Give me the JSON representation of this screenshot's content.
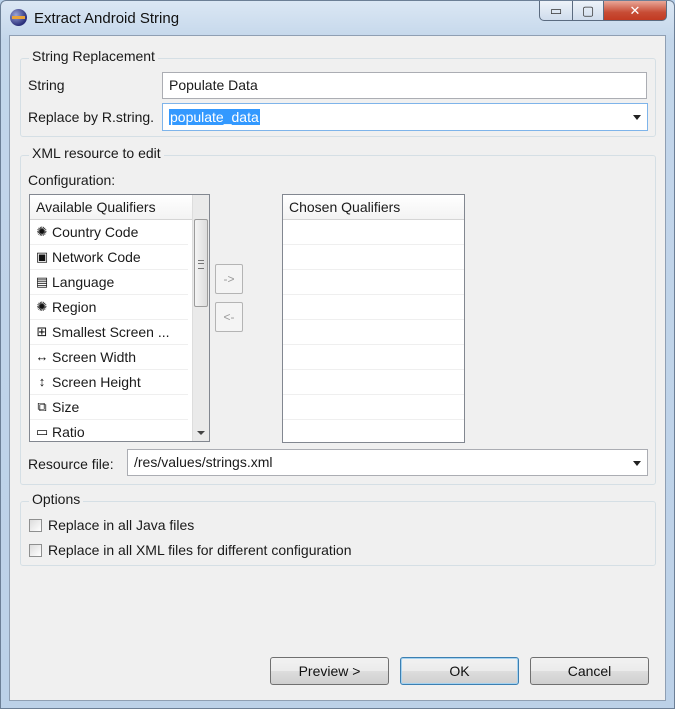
{
  "window": {
    "title": "Extract Android String",
    "controls": {
      "minimize": "▭",
      "maximize": "▢",
      "close": "✕"
    }
  },
  "string_replacement": {
    "group_title": "String Replacement",
    "string_label": "String",
    "string_value": "Populate Data",
    "replace_label": "Replace by R.string.",
    "replace_value": "populate_data"
  },
  "xml_resource": {
    "group_title": "XML resource to edit",
    "configuration_label": "Configuration:",
    "available_header": "Available Qualifiers",
    "available_qualifiers": [
      {
        "icon": "country-code-icon",
        "glyph": "✺",
        "label": "Country Code"
      },
      {
        "icon": "network-code-icon",
        "glyph": "▣",
        "label": "Network Code"
      },
      {
        "icon": "language-icon",
        "glyph": "▤",
        "label": "Language"
      },
      {
        "icon": "region-icon",
        "glyph": "✺",
        "label": "Region"
      },
      {
        "icon": "smallest-screen-icon",
        "glyph": "⊞",
        "label": "Smallest Screen ..."
      },
      {
        "icon": "screen-width-icon",
        "glyph": "↔",
        "label": "Screen Width"
      },
      {
        "icon": "screen-height-icon",
        "glyph": "↕",
        "label": "Screen Height"
      },
      {
        "icon": "size-icon",
        "glyph": "⧉",
        "label": "Size"
      },
      {
        "icon": "ratio-icon",
        "glyph": "▭",
        "label": "Ratio"
      }
    ],
    "add_button": "->",
    "remove_button": "<-",
    "chosen_header": "Chosen Qualifiers",
    "resource_file_label": "Resource file:",
    "resource_file_value": "/res/values/strings.xml"
  },
  "options": {
    "group_title": "Options",
    "replace_java": "Replace in all Java files",
    "replace_xml": "Replace in all XML files for different configuration"
  },
  "buttons": {
    "preview": "Preview >",
    "ok": "OK",
    "cancel": "Cancel"
  }
}
